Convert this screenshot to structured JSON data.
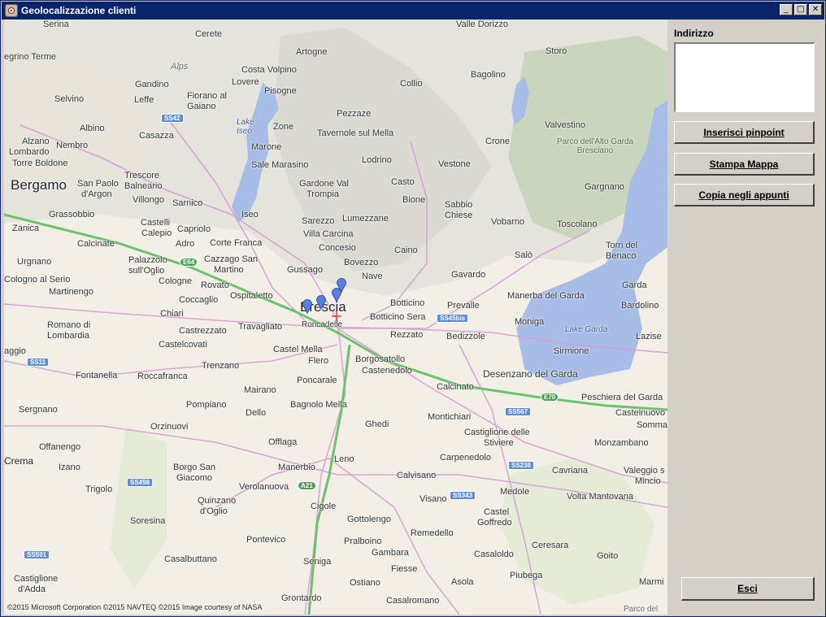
{
  "window": {
    "title": "Geolocalizzazione clienti",
    "controls": {
      "minimize": "_",
      "maximize": "□",
      "close": "✕"
    }
  },
  "map": {
    "places": [
      {
        "id": "serina",
        "label": "Serina"
      },
      {
        "id": "cerete",
        "label": "Cerete"
      },
      {
        "id": "artogne",
        "label": "Artogne"
      },
      {
        "id": "valle-dorizzo",
        "label": "Valle Dorizzo"
      },
      {
        "id": "storo",
        "label": "Storo"
      },
      {
        "id": "egrino-terme",
        "label": "egrino Terme"
      },
      {
        "id": "alps",
        "label": "Alps"
      },
      {
        "id": "costa-volpino",
        "label": "Costa Volpino"
      },
      {
        "id": "bagolino",
        "label": "Bagolino"
      },
      {
        "id": "gandino",
        "label": "Gandino"
      },
      {
        "id": "lovere",
        "label": "Lovere"
      },
      {
        "id": "collio",
        "label": "Collio"
      },
      {
        "id": "selvino",
        "label": "Selvino"
      },
      {
        "id": "leffe",
        "label": "Leffe"
      },
      {
        "id": "fiorano",
        "label": "Fiorano al"
      },
      {
        "id": "gaiano",
        "label": "Gaiano"
      },
      {
        "id": "pisogne",
        "label": "Pisogne"
      },
      {
        "id": "pezzaze",
        "label": "Pezzaze"
      },
      {
        "id": "albino",
        "label": "Albino"
      },
      {
        "id": "zone",
        "label": "Zone"
      },
      {
        "id": "tavernole",
        "label": "Tavernole sul Mella"
      },
      {
        "id": "crone",
        "label": "Crone"
      },
      {
        "id": "valvestino",
        "label": "Valvestino"
      },
      {
        "id": "alzano",
        "label": "Alzano"
      },
      {
        "id": "lombardo",
        "label": "Lombardo"
      },
      {
        "id": "nembro",
        "label": "Nembro"
      },
      {
        "id": "casazza",
        "label": "Casazza"
      },
      {
        "id": "marone",
        "label": "Marone"
      },
      {
        "id": "lodrino",
        "label": "Lodrino"
      },
      {
        "id": "torre-boldone",
        "label": "Torre Boldone"
      },
      {
        "id": "sale-marasino",
        "label": "Sale Marasino"
      },
      {
        "id": "vestone",
        "label": "Vestone"
      },
      {
        "id": "trescore",
        "label": "Trescore"
      },
      {
        "id": "balneario",
        "label": "Balneario"
      },
      {
        "id": "bergamo",
        "label": "Bergamo"
      },
      {
        "id": "san-paolo",
        "label": "San Paolo"
      },
      {
        "id": "d-argon",
        "label": "d'Argon"
      },
      {
        "id": "gardone",
        "label": "Gardone Val"
      },
      {
        "id": "trompia",
        "label": "Trompia"
      },
      {
        "id": "casto",
        "label": "Casto"
      },
      {
        "id": "gargnano",
        "label": "Gargnano"
      },
      {
        "id": "villongo",
        "label": "Villongo"
      },
      {
        "id": "sarnico",
        "label": "Sarnico"
      },
      {
        "id": "bione",
        "label": "Bione"
      },
      {
        "id": "sabbio",
        "label": "Sabbio"
      },
      {
        "id": "chiese",
        "label": "Chiese"
      },
      {
        "id": "grassobbio",
        "label": "Grassobbio"
      },
      {
        "id": "iseo",
        "label": "Iseo"
      },
      {
        "id": "sarezzo",
        "label": "Sarezzo"
      },
      {
        "id": "lumezzane",
        "label": "Lumezzane"
      },
      {
        "id": "vobarno",
        "label": "Vobarno"
      },
      {
        "id": "toscolano",
        "label": "Toscolano"
      },
      {
        "id": "zanica",
        "label": "Zanica"
      },
      {
        "id": "castelli",
        "label": "Castelli"
      },
      {
        "id": "calepio",
        "label": "Calepio"
      },
      {
        "id": "capriolo",
        "label": "Capriolo"
      },
      {
        "id": "villa-carcina",
        "label": "Villa Carcina"
      },
      {
        "id": "calcinate",
        "label": "Calcinate"
      },
      {
        "id": "adro",
        "label": "Adro"
      },
      {
        "id": "corte-franca",
        "label": "Corte Franca"
      },
      {
        "id": "concesio",
        "label": "Concesio"
      },
      {
        "id": "caino",
        "label": "Caino"
      },
      {
        "id": "salo",
        "label": "Salò"
      },
      {
        "id": "torri",
        "label": "Torri del"
      },
      {
        "id": "benaco",
        "label": "Benaco"
      },
      {
        "id": "urgnano",
        "label": "Urgnano"
      },
      {
        "id": "palazzolo",
        "label": "Palazzolo"
      },
      {
        "id": "sull-oglio",
        "label": "sull'Oglio"
      },
      {
        "id": "cazzago",
        "label": "Cazzago San"
      },
      {
        "id": "martino",
        "label": "Martino"
      },
      {
        "id": "bovezzo",
        "label": "Bovezzo"
      },
      {
        "id": "gussago",
        "label": "Gussago"
      },
      {
        "id": "nave",
        "label": "Nave"
      },
      {
        "id": "gavardo",
        "label": "Gavardo"
      },
      {
        "id": "cologno",
        "label": "Cologno al Serio"
      },
      {
        "id": "cologne",
        "label": "Cologne"
      },
      {
        "id": "rovato",
        "label": "Rovato"
      },
      {
        "id": "garda",
        "label": "Garda"
      },
      {
        "id": "martinengo",
        "label": "Martinengo"
      },
      {
        "id": "ospitaletto",
        "label": "Ospitaletto"
      },
      {
        "id": "coccaglio",
        "label": "Coccaglio"
      },
      {
        "id": "brescia",
        "label": "Brescia"
      },
      {
        "id": "botticino",
        "label": "Botticino"
      },
      {
        "id": "prevalle",
        "label": "Prevalle"
      },
      {
        "id": "manerba",
        "label": "Manerba del Garda"
      },
      {
        "id": "bardolino",
        "label": "Bardolino"
      },
      {
        "id": "romano",
        "label": "Romano di"
      },
      {
        "id": "lombardia",
        "label": "Lombardia"
      },
      {
        "id": "chiari",
        "label": "Chiari"
      },
      {
        "id": "botticino-sera",
        "label": "Botticino Sera"
      },
      {
        "id": "travagliato",
        "label": "Travagliato"
      },
      {
        "id": "roncadelle",
        "label": "Roncadelle"
      },
      {
        "id": "castrezzato",
        "label": "Castrezzato"
      },
      {
        "id": "rezzato",
        "label": "Rezzato"
      },
      {
        "id": "bedizzole",
        "label": "Bedizzole"
      },
      {
        "id": "moniga",
        "label": "Moniga"
      },
      {
        "id": "lake-garda",
        "label": "Lake Garda"
      },
      {
        "id": "lazise",
        "label": "Lazise"
      },
      {
        "id": "castelcovati",
        "label": "Castelcovati"
      },
      {
        "id": "aggio",
        "label": "aggio"
      },
      {
        "id": "castel-mella",
        "label": "Castel Mella"
      },
      {
        "id": "flero",
        "label": "Flero"
      },
      {
        "id": "borgosatollo",
        "label": "Borgosatollo"
      },
      {
        "id": "sirmione",
        "label": "Sirmione"
      },
      {
        "id": "trenzano",
        "label": "Trenzano"
      },
      {
        "id": "castenedolo",
        "label": "Castenedolo"
      },
      {
        "id": "fontanella",
        "label": "Fontanella"
      },
      {
        "id": "roccafranca",
        "label": "Roccafranca"
      },
      {
        "id": "desenzano",
        "label": "Desenzano del Garda"
      },
      {
        "id": "poncarale",
        "label": "Poncarale"
      },
      {
        "id": "calcinato",
        "label": "Calcinato"
      },
      {
        "id": "mairano",
        "label": "Mairano"
      },
      {
        "id": "peschiera",
        "label": "Peschiera del Garda"
      },
      {
        "id": "pompiano",
        "label": "Pompiano"
      },
      {
        "id": "bagnolo",
        "label": "Bagnolo Mella"
      },
      {
        "id": "sergnano",
        "label": "Sergnano"
      },
      {
        "id": "dello",
        "label": "Dello"
      },
      {
        "id": "castelnuovo",
        "label": "Castelnuovo"
      },
      {
        "id": "montichiari",
        "label": "Montichiari"
      },
      {
        "id": "sommac",
        "label": "Sommac"
      },
      {
        "id": "orzinuovi",
        "label": "Orzinuovi"
      },
      {
        "id": "ghedi",
        "label": "Ghedi"
      },
      {
        "id": "castiglione",
        "label": "Castiglione delle"
      },
      {
        "id": "stiviere",
        "label": "Stiviere"
      },
      {
        "id": "offanengo",
        "label": "Offanengo"
      },
      {
        "id": "offlaga",
        "label": "Offlaga"
      },
      {
        "id": "monzambano",
        "label": "Monzambano"
      },
      {
        "id": "crema",
        "label": "Crema"
      },
      {
        "id": "leno",
        "label": "Leno"
      },
      {
        "id": "carpenedolo",
        "label": "Carpenedolo"
      },
      {
        "id": "izano",
        "label": "Izano"
      },
      {
        "id": "borgo-san",
        "label": "Borgo San"
      },
      {
        "id": "giacomo",
        "label": "Giacomo"
      },
      {
        "id": "manerbio",
        "label": "Manerbio"
      },
      {
        "id": "cavriana",
        "label": "Cavriana"
      },
      {
        "id": "valeggio",
        "label": "Valeggio s"
      },
      {
        "id": "calvisano",
        "label": "Calvisano"
      },
      {
        "id": "mincio",
        "label": "Mincio"
      },
      {
        "id": "trigolo",
        "label": "Trigolo"
      },
      {
        "id": "verolanuova",
        "label": "Verolanuova"
      },
      {
        "id": "medole",
        "label": "Medole"
      },
      {
        "id": "volta",
        "label": "Volta Mantovana"
      },
      {
        "id": "visano",
        "label": "Visano"
      },
      {
        "id": "quinzano",
        "label": "Quinzano"
      },
      {
        "id": "d-oglio",
        "label": "d'Oglio"
      },
      {
        "id": "cigole",
        "label": "Cigole"
      },
      {
        "id": "castel",
        "label": "Castel"
      },
      {
        "id": "goffredo",
        "label": "Goffredo"
      },
      {
        "id": "gottolengo",
        "label": "Gottolengo"
      },
      {
        "id": "soresina",
        "label": "Soresina"
      },
      {
        "id": "remedello",
        "label": "Remedello"
      },
      {
        "id": "pontevico",
        "label": "Pontevico"
      },
      {
        "id": "pralboino",
        "label": "Pralboino"
      },
      {
        "id": "ceresara",
        "label": "Ceresara"
      },
      {
        "id": "gambara",
        "label": "Gambara"
      },
      {
        "id": "casalbuttano",
        "label": "Casalbuttano"
      },
      {
        "id": "casaloldo",
        "label": "Casaloldo"
      },
      {
        "id": "goito",
        "label": "Goito"
      },
      {
        "id": "seniga",
        "label": "Seniga"
      },
      {
        "id": "fiesse",
        "label": "Fiesse"
      },
      {
        "id": "piubega",
        "label": "Piubega"
      },
      {
        "id": "castiglione-dadda",
        "label": "Castiglione"
      },
      {
        "id": "d-adda",
        "label": "d'Adda"
      },
      {
        "id": "ostiano",
        "label": "Ostiano"
      },
      {
        "id": "asola",
        "label": "Asola"
      },
      {
        "id": "marmi",
        "label": "Marmi"
      },
      {
        "id": "grontardo",
        "label": "Grontardo"
      },
      {
        "id": "casalromano",
        "label": "Casalromano"
      },
      {
        "id": "parco-del",
        "label": "Parco del"
      },
      {
        "id": "lake-iseo",
        "label": "Lake Iseo"
      },
      {
        "id": "parco-alto-garda",
        "label": "Parco dell'Alto Garda Bresciano"
      }
    ],
    "roads": [
      {
        "id": "ss42",
        "label": "SS42"
      },
      {
        "id": "e64",
        "label": "E64"
      },
      {
        "id": "ss45bis",
        "label": "SS45bis"
      },
      {
        "id": "ss11",
        "label": "SS11"
      },
      {
        "id": "e70",
        "label": "E70"
      },
      {
        "id": "ss567",
        "label": "SS567"
      },
      {
        "id": "ss236",
        "label": "SS236"
      },
      {
        "id": "ss498",
        "label": "SS498"
      },
      {
        "id": "a21",
        "label": "A21"
      },
      {
        "id": "ss343",
        "label": "SS343"
      },
      {
        "id": "ss591",
        "label": "SS591"
      }
    ],
    "credits": "©2015 Microsoft Corporation  ©2015 NAVTEQ  ©2015 Image courtesy of NASA",
    "colors": {
      "water": "#a7bde8",
      "land": "#f3efe6",
      "highway": "#6cc26c",
      "road": "#d59ad5",
      "mountain": "#cfd8c5"
    }
  },
  "panel": {
    "address_label": "Indirizzo",
    "address_value": "",
    "btn_pinpoint": "Inserisci pinpoint",
    "btn_print": "Stampa Mappa",
    "btn_copy": "Copia negli appunti",
    "btn_exit": "Esci"
  }
}
